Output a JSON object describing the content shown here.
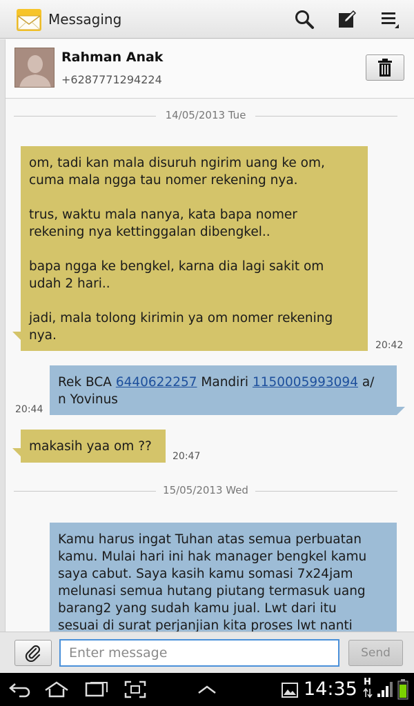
{
  "app": {
    "title": "Messaging"
  },
  "action_bar": {
    "icons": [
      "search-icon",
      "compose-icon",
      "menu-icon"
    ]
  },
  "contact": {
    "name": "Rahman Anak",
    "number": "+6287771294224"
  },
  "conversation": {
    "date_1": "14/05/2013 Tue",
    "date_2": "15/05/2013 Wed",
    "messages": [
      {
        "direction": "incoming",
        "text": "om, tadi kan mala disuruh ngirim uang ke om,\ncuma mala ngga tau nomer rekening nya.\n\ntrus, waktu mala nanya, kata bapa nomer\nrekening nya kettinggalan dibengkel..\n\nbapa ngga ke bengkel, karna dia lagi sakit om\nudah 2 hari..\n\njadi, mala tolong kirimin ya om nomer rekening\nnya.",
        "time": "20:42"
      },
      {
        "direction": "outgoing",
        "text_prefix": "Rek BCA ",
        "link_1": "6440622257",
        "text_middle": " Mandiri ",
        "link_2": "1150005993094",
        "text_suffix": " a/\nn Yovinus",
        "time": "20:44"
      },
      {
        "direction": "incoming",
        "text": "makasih yaa om ??",
        "time": "20:47"
      },
      {
        "direction": "outgoing",
        "text": "Kamu harus ingat Tuhan atas semua perbuatan\nkamu. Mulai hari ini hak manager bengkel kamu\nsaya cabut. Saya kasih kamu somasi 7x24jam\nmelunasi semua hutang piutang termasuk uang\nbarang2 yang sudah kamu jual. Lwt dari itu\nsesuai di surat perjanjian kita proses lwt nanti"
      }
    ]
  },
  "composer": {
    "placeholder": "Enter message",
    "send_label": "Send"
  },
  "status_bar": {
    "time": "14:35",
    "network": "H"
  },
  "colors": {
    "incoming_bubble": "#d4c46a",
    "outgoing_bubble": "#9dbcd6",
    "link": "#1d4f9c",
    "input_focus": "#4a90d9"
  }
}
